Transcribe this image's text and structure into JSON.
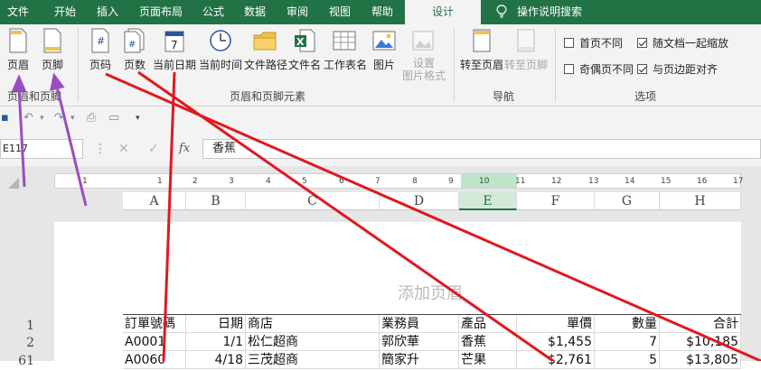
{
  "tabs": [
    {
      "label": "文件"
    },
    {
      "label": "开始"
    },
    {
      "label": "插入"
    },
    {
      "label": "页面布局"
    },
    {
      "label": "公式"
    },
    {
      "label": "数据"
    },
    {
      "label": "审阅"
    },
    {
      "label": "视图"
    },
    {
      "label": "帮助"
    },
    {
      "label": "设计"
    }
  ],
  "tell_me": "操作说明搜索",
  "ribbon": {
    "group1": {
      "label": "页眉和页脚",
      "buttons": [
        {
          "label": "页眉",
          "icon": "header-page-icon"
        },
        {
          "label": "页脚",
          "icon": "footer-page-icon"
        }
      ]
    },
    "group2": {
      "label": "页眉和页脚元素",
      "buttons": [
        {
          "label": "页码",
          "icon": "page-number-icon"
        },
        {
          "label": "页数",
          "icon": "page-count-icon"
        },
        {
          "label": "当前日期",
          "icon": "calendar-icon"
        },
        {
          "label": "当前时间",
          "icon": "clock-icon"
        },
        {
          "label": "文件路径",
          "icon": "folder-icon"
        },
        {
          "label": "文件名",
          "icon": "excel-file-icon"
        },
        {
          "label": "工作表名",
          "icon": "sheet-grid-icon"
        },
        {
          "label": "图片",
          "icon": "picture-icon"
        },
        {
          "label": "设置",
          "label2": "图片格式",
          "icon": "format-picture-icon"
        }
      ]
    },
    "group3": {
      "label": "导航",
      "buttons": [
        {
          "label": "转至页眉",
          "icon": "goto-header-icon"
        },
        {
          "label": "转至页脚",
          "icon": "goto-footer-icon"
        }
      ]
    },
    "group4": {
      "label": "选项",
      "options": [
        {
          "label": "首页不同",
          "checked": false
        },
        {
          "label": "随文档一起缩放",
          "checked": true
        },
        {
          "label": "奇偶页不同",
          "checked": false
        },
        {
          "label": "与页边距对齐",
          "checked": true
        }
      ]
    }
  },
  "formula_bar": {
    "name_box": "E117",
    "cancel": "✕",
    "enter": "✓",
    "fx": "fx",
    "value": "香蕉"
  },
  "ruler_ticks": [
    "1",
    "1",
    "2",
    "3",
    "4",
    "5",
    "6",
    "7",
    "8",
    "9",
    "10",
    "11",
    "12",
    "13",
    "14",
    "15",
    "16",
    "17"
  ],
  "columns": [
    "A",
    "B",
    "C",
    "D",
    "E",
    "F",
    "G",
    "H"
  ],
  "header_placeholder": "添加页眉",
  "rows": [
    {
      "num": "1",
      "cells": [
        "訂單號碼",
        "日期",
        "商店",
        "業務員",
        "產品",
        "單價",
        "數量",
        "合計"
      ]
    },
    {
      "num": "2",
      "cells": [
        "A0001",
        "1/1",
        "松仁超商",
        "郭欣華",
        "香蕉",
        "$1,455",
        "7",
        "$10,185"
      ]
    },
    {
      "num": "61",
      "cells": [
        "A0060",
        "4/18",
        "三茂超商",
        "簡家升",
        "芒果",
        "$2,761",
        "5",
        "$13,805"
      ]
    }
  ],
  "colors": {
    "excel_green": "#217346",
    "annotation_red": "#e0181f",
    "annotation_purple": "#9b4dc0"
  }
}
